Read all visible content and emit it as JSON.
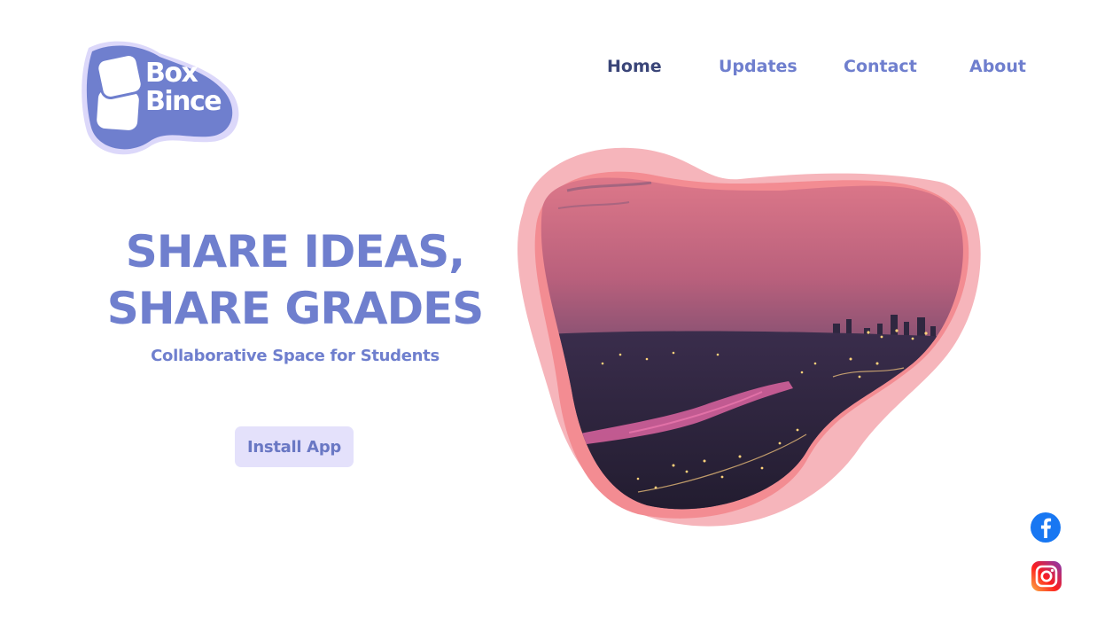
{
  "brand": {
    "line1": "Box",
    "line2": "Bince",
    "blob_color": "#6f7fce",
    "halo_color": "#dcd8fa"
  },
  "nav": {
    "items": [
      {
        "label": "Home",
        "active": true
      },
      {
        "label": "Updates",
        "active": false
      },
      {
        "label": "Contact",
        "active": false
      },
      {
        "label": "About",
        "active": false
      }
    ]
  },
  "hero": {
    "title_line1": "SHARE IDEAS,",
    "title_line2": "SHARE GRADES",
    "subtitle": "Collaborative Space for Students",
    "cta_label": "Install App"
  },
  "image": {
    "subject": "city skyline at dusk over a river",
    "frame_color_outer": "#f6b5bb",
    "frame_color_inner": "#f38c92"
  },
  "social": {
    "icons": [
      "facebook-icon",
      "instagram-icon"
    ]
  },
  "colors": {
    "accent": "#6f7fce",
    "nav_active": "#3a4578",
    "button_bg": "#e4e1fb"
  }
}
